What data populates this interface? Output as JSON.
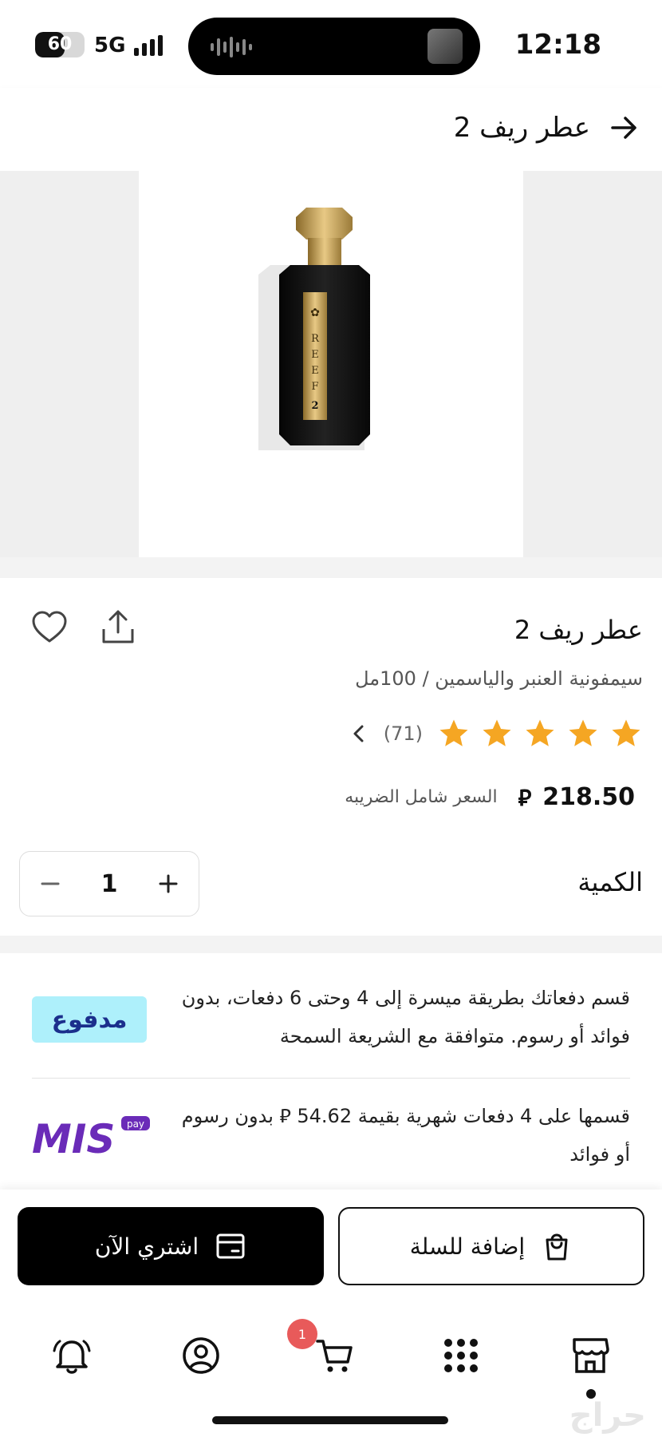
{
  "status_bar": {
    "battery": "60",
    "network": "5G",
    "time": "12:18"
  },
  "header": {
    "title": "عطر ريف 2"
  },
  "product": {
    "title": "عطر ريف 2",
    "subtitle": "سيمفونية العنبر والياسمين / 100مل",
    "rating_stars": 5,
    "review_count": "(71)",
    "price": "218.50",
    "currency_symbol": "⃁",
    "tax_note": "السعر شامل الضريبه",
    "quantity_label": "الكمية",
    "quantity": "1",
    "bottle_brand": "REEF",
    "bottle_number": "2"
  },
  "installments": [
    {
      "text": "قسم دفعاتك بطريقة ميسرة إلى 4 وحتى 6 دفعات، بدون فوائد أو رسوم. متوافقة مع الشريعة السمحة",
      "logo_text": "مدفوع"
    },
    {
      "text": "قسمها على 4 دفعات شهرية بقيمة 54.62 ⃁ بدون رسوم أو فوائد",
      "logo_text": "MIS",
      "logo_sub": "pay"
    }
  ],
  "actions": {
    "buy_now": "اشتري الآن",
    "add_to_cart": "إضافة للسلة"
  },
  "nav": {
    "cart_badge": "1"
  },
  "watermark": "حراج",
  "colors": {
    "primary": "#000000",
    "star": "#f5a623",
    "badge": "#e85a5a",
    "madfu_bg": "#aef0fb",
    "mis_purple": "#6a2bb8"
  }
}
